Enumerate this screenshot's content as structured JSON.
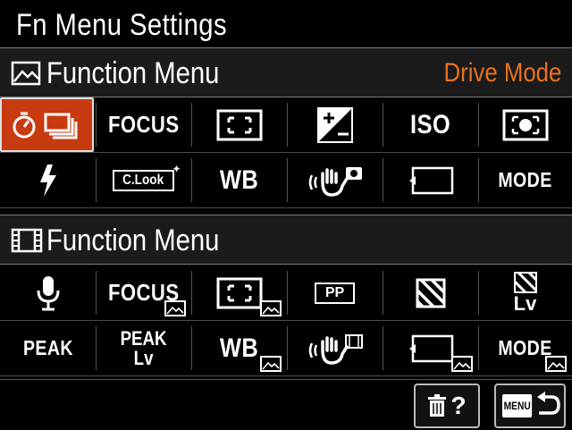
{
  "title": "Fn Menu Settings",
  "still_section": {
    "heading": "Function Menu",
    "current_item": "Drive Mode",
    "row1": [
      "drive-mode",
      "FOCUS",
      "focus-area",
      "exposure-comp",
      "ISO",
      "metering"
    ],
    "row2": [
      "flash",
      "C.Look",
      "WB",
      "steady-shot",
      "memory-recall",
      "MODE"
    ]
  },
  "movie_section": {
    "heading": "Function Menu",
    "row1": [
      "audio",
      "FOCUS",
      "focus-area",
      "PP",
      "zebra",
      "zebra-Lv"
    ],
    "row2": [
      "PEAK",
      "PEAK Lv",
      "WB",
      "steady-shot-movie",
      "memory-recall-movie",
      "MODE"
    ]
  },
  "labels": {
    "focus": "FOCUS",
    "iso": "ISO",
    "clook": "C.Look",
    "wb": "WB",
    "mode": "MODE",
    "pp": "PP",
    "lv": "Lv",
    "peak": "PEAK",
    "peak_lv_top": "PEAK",
    "peak_lv_bottom": "Lv"
  },
  "footer": {
    "delete_help_label": "?",
    "menu_label": "MENU"
  },
  "colors": {
    "accent": "#e8721d",
    "selected_bg": "#c83a10",
    "header_bg": "#1b1b1b"
  }
}
